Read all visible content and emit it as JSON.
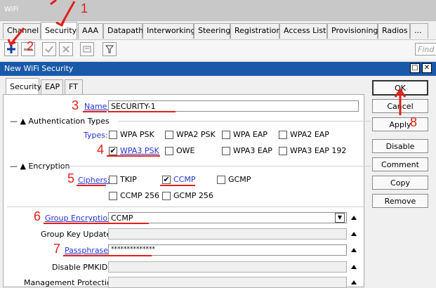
{
  "window": {
    "title": "WiFi"
  },
  "tabs": [
    "Channel",
    "Security",
    "AAA",
    "Datapath",
    "Interworking",
    "Steering",
    "Registration",
    "Access List",
    "Provisioning",
    "Radios",
    "..."
  ],
  "toolbar": {
    "find_placeholder": "Find"
  },
  "dialog": {
    "title": "New WiFi Security",
    "tabs": [
      "Security",
      "EAP",
      "FT"
    ],
    "name_label": "Name:",
    "name_value": "SECURITY-1",
    "auth_section": "Authentication Types",
    "types_label": "Types:",
    "types": [
      {
        "label": "WPA PSK",
        "checked": false
      },
      {
        "label": "WPA2 PSK",
        "checked": false
      },
      {
        "label": "WPA EAP",
        "checked": false
      },
      {
        "label": "WPA2 EAP",
        "checked": false
      },
      {
        "label": "WPA3 PSK",
        "checked": true
      },
      {
        "label": "OWE",
        "checked": false
      },
      {
        "label": "WPA3 EAP",
        "checked": false
      },
      {
        "label": "WPA3 EAP 192",
        "checked": false
      }
    ],
    "enc_section": "Encryption",
    "ciphers_label": "Ciphers:",
    "ciphers": [
      {
        "label": "TKIP",
        "checked": false
      },
      {
        "label": "CCMP",
        "checked": true
      },
      {
        "label": "GCMP",
        "checked": false
      },
      {
        "label": "CCMP 256",
        "checked": false
      },
      {
        "label": "GCMP 256",
        "checked": false
      }
    ],
    "group_enc_label": "Group Encryption:",
    "group_enc_value": "CCMP",
    "group_key_label": "Group Key Update:",
    "passphrase_label": "Passphrase:",
    "passphrase_value": "**************",
    "disable_pmkid_label": "Disable PMKID:",
    "mgmt_prot_label": "Management Protection:"
  },
  "buttons": [
    "OK",
    "Cancel",
    "Apply",
    "Disable",
    "Comment",
    "Copy",
    "Remove"
  ],
  "annotations": [
    "1",
    "2",
    "3",
    "4",
    "5",
    "6",
    "7",
    "8"
  ],
  "colors": {
    "accent": "#1a59a8",
    "annotation": "#e0201a",
    "link": "#2233cc"
  }
}
